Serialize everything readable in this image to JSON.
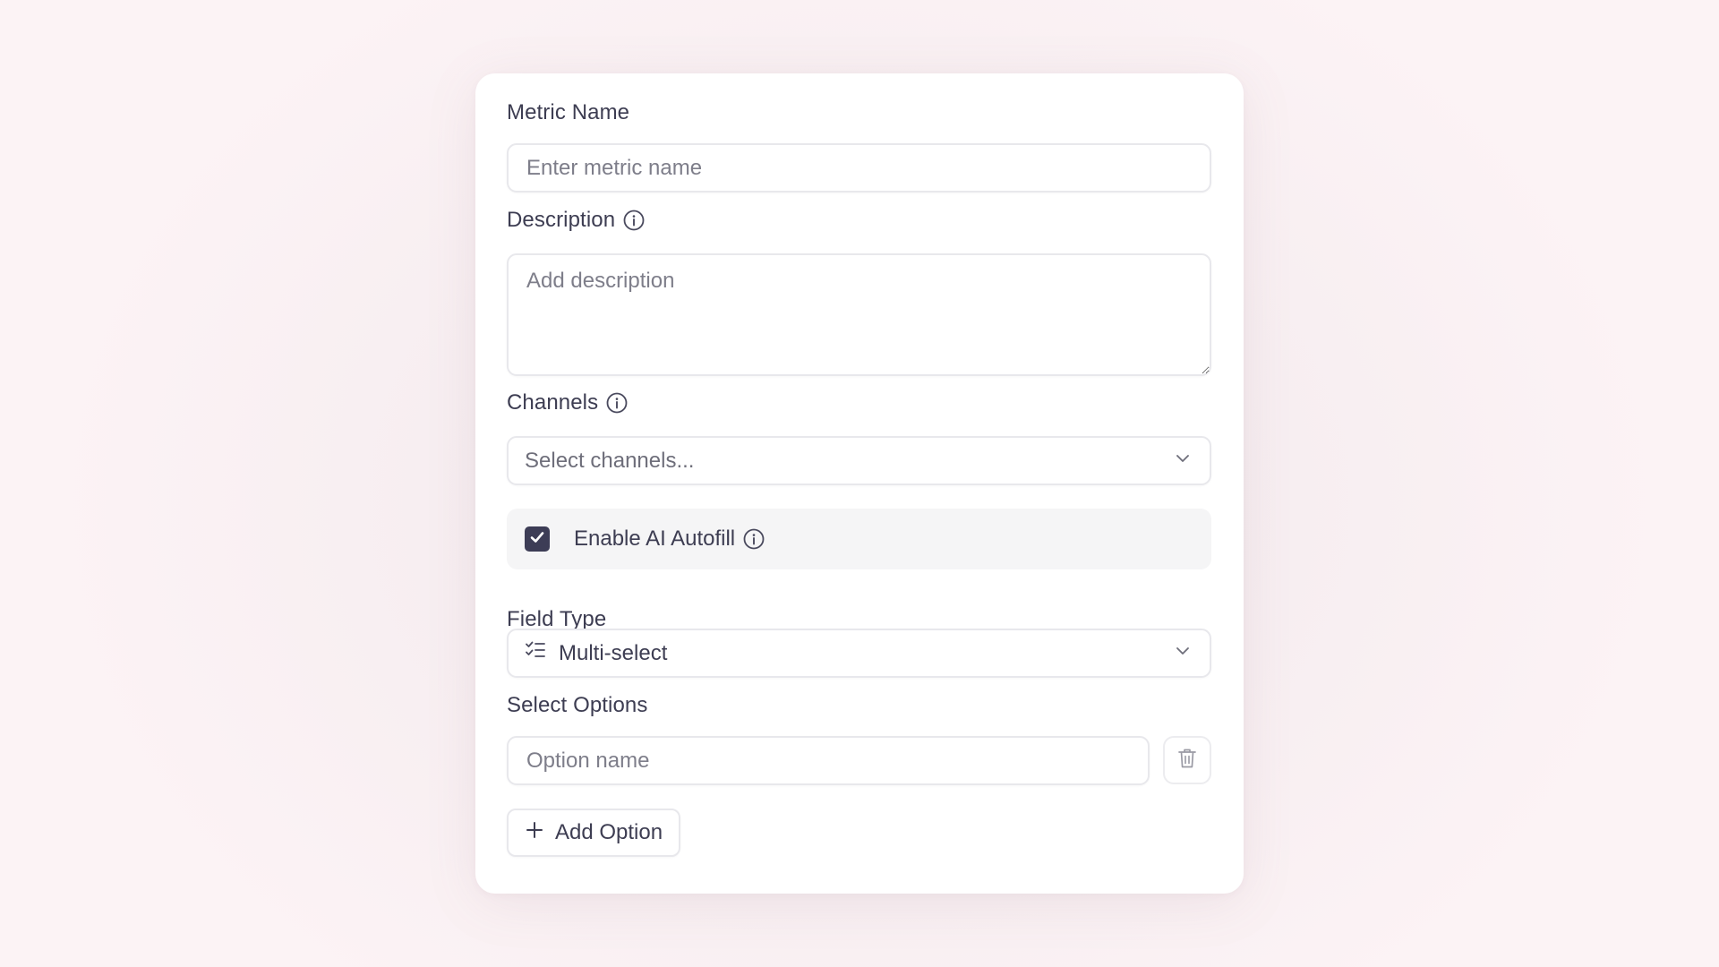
{
  "form": {
    "metric_name": {
      "label": "Metric Name",
      "placeholder": "Enter metric name",
      "value": ""
    },
    "description": {
      "label": "Description",
      "placeholder": "Add description",
      "value": ""
    },
    "channels": {
      "label": "Channels",
      "placeholder": "Select channels..."
    },
    "ai_autofill": {
      "label": "Enable AI Autofill",
      "checked": true
    },
    "field_type": {
      "label": "Field Type",
      "selected": "Multi-select",
      "icon": "multi-select-list-icon"
    },
    "select_options": {
      "label": "Select Options",
      "options": [
        {
          "placeholder": "Option name",
          "value": ""
        }
      ],
      "add_label": "Add Option"
    }
  },
  "icons": {
    "info": "info-icon",
    "chevron": "chevron-down-icon",
    "trash": "trash-icon",
    "plus": "plus-icon",
    "check": "check-icon"
  },
  "colors": {
    "checkbox_fill": "#3d3d56",
    "text": "#3d3d52",
    "placeholder": "#7e7e8a"
  }
}
